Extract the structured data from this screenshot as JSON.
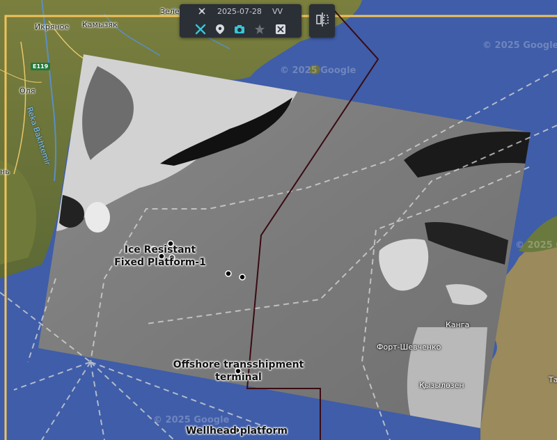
{
  "toolbar": {
    "date": "2025-07-28",
    "polarization": "VV",
    "buttons": [
      {
        "name": "tools-icon",
        "active": true
      },
      {
        "name": "location-pin-icon",
        "active": true
      },
      {
        "name": "camera-icon",
        "active": true
      },
      {
        "name": "star-icon",
        "active": false
      },
      {
        "name": "cut-icon",
        "active": false
      }
    ]
  },
  "places": {
    "ikryanoe": "Икряное",
    "kamyzyak": "Камызяк",
    "zelenga": "Зеленга",
    "olya": "Оля",
    "river": "Reka Bakhtemir",
    "road": "E119",
    "edge_left": "нь",
    "kanga": "Канга",
    "fort_shevchenko": "Форт-Шевченко",
    "kyzylozen": "Қызылөзен",
    "edge_right": "Та"
  },
  "watermarks": [
    "© 2025 Google",
    "© 2025 Google",
    "© 2025 Google",
    "© 2025 Google"
  ],
  "features": {
    "ice_platform": "Ice Resistant Fixed Platform-1",
    "offshore_terminal": "Offshore transshipment terminal",
    "wellhead": "Wellhead platform"
  },
  "colors": {
    "sea": "#3f5da8",
    "boundary": "#f2c25a",
    "route_line": "#3b0a12",
    "shipping_lanes": "#d9d9d9",
    "toolbar_bg": "#2b2f36",
    "toolbar_accent": "#37c6d8"
  }
}
